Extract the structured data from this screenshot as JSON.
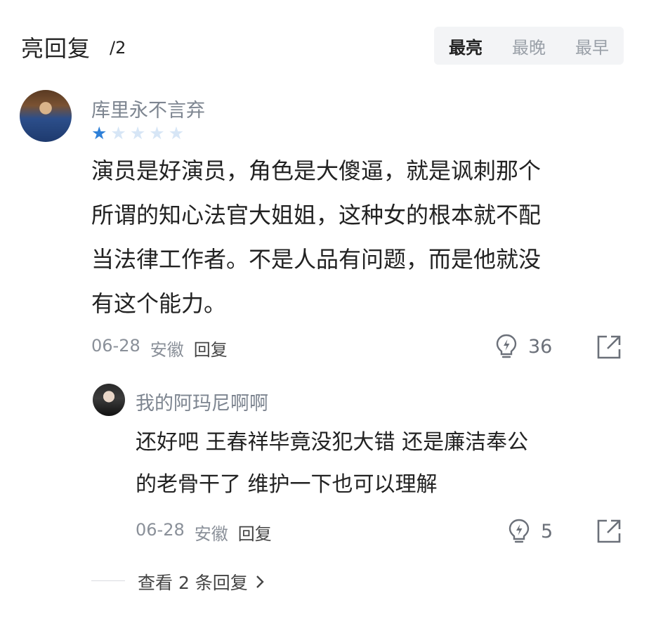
{
  "header": {
    "title": "亮回复",
    "count": "/2",
    "sort_tabs": [
      {
        "label": "最亮",
        "active": true
      },
      {
        "label": "最晚",
        "active": false
      },
      {
        "label": "最早",
        "active": false
      }
    ]
  },
  "comment": {
    "username": "库里永不言弃",
    "rating": {
      "value": 1,
      "max": 5
    },
    "lines": [
      "演员是好演员，角色是大傻逼，就是讽刺那个",
      "所谓的知心法官大姐姐，这种女的根本就不配",
      "当法律工作者。不是人品有问题，而是他就没",
      "有这个能力。"
    ],
    "date": "06-28",
    "location": "安徽",
    "reply_label": "回复",
    "likes": "36"
  },
  "reply": {
    "username": "我的阿玛尼啊啊",
    "lines": [
      "还好吧 王春祥毕竟没犯大错 还是廉洁奉公",
      "的老骨干了 维护一下也可以理解"
    ],
    "date": "06-28",
    "location": "安徽",
    "reply_label": "回复",
    "likes": "5"
  },
  "view_replies": {
    "label": "查看 2 条回复"
  },
  "colors": {
    "star_filled": "#2f80d8",
    "star_empty": "#d7e6f6",
    "muted_text": "#8a9099"
  },
  "icons": [
    "lightbulb-like-icon",
    "share-icon",
    "chevron-right-icon",
    "star-icon"
  ]
}
